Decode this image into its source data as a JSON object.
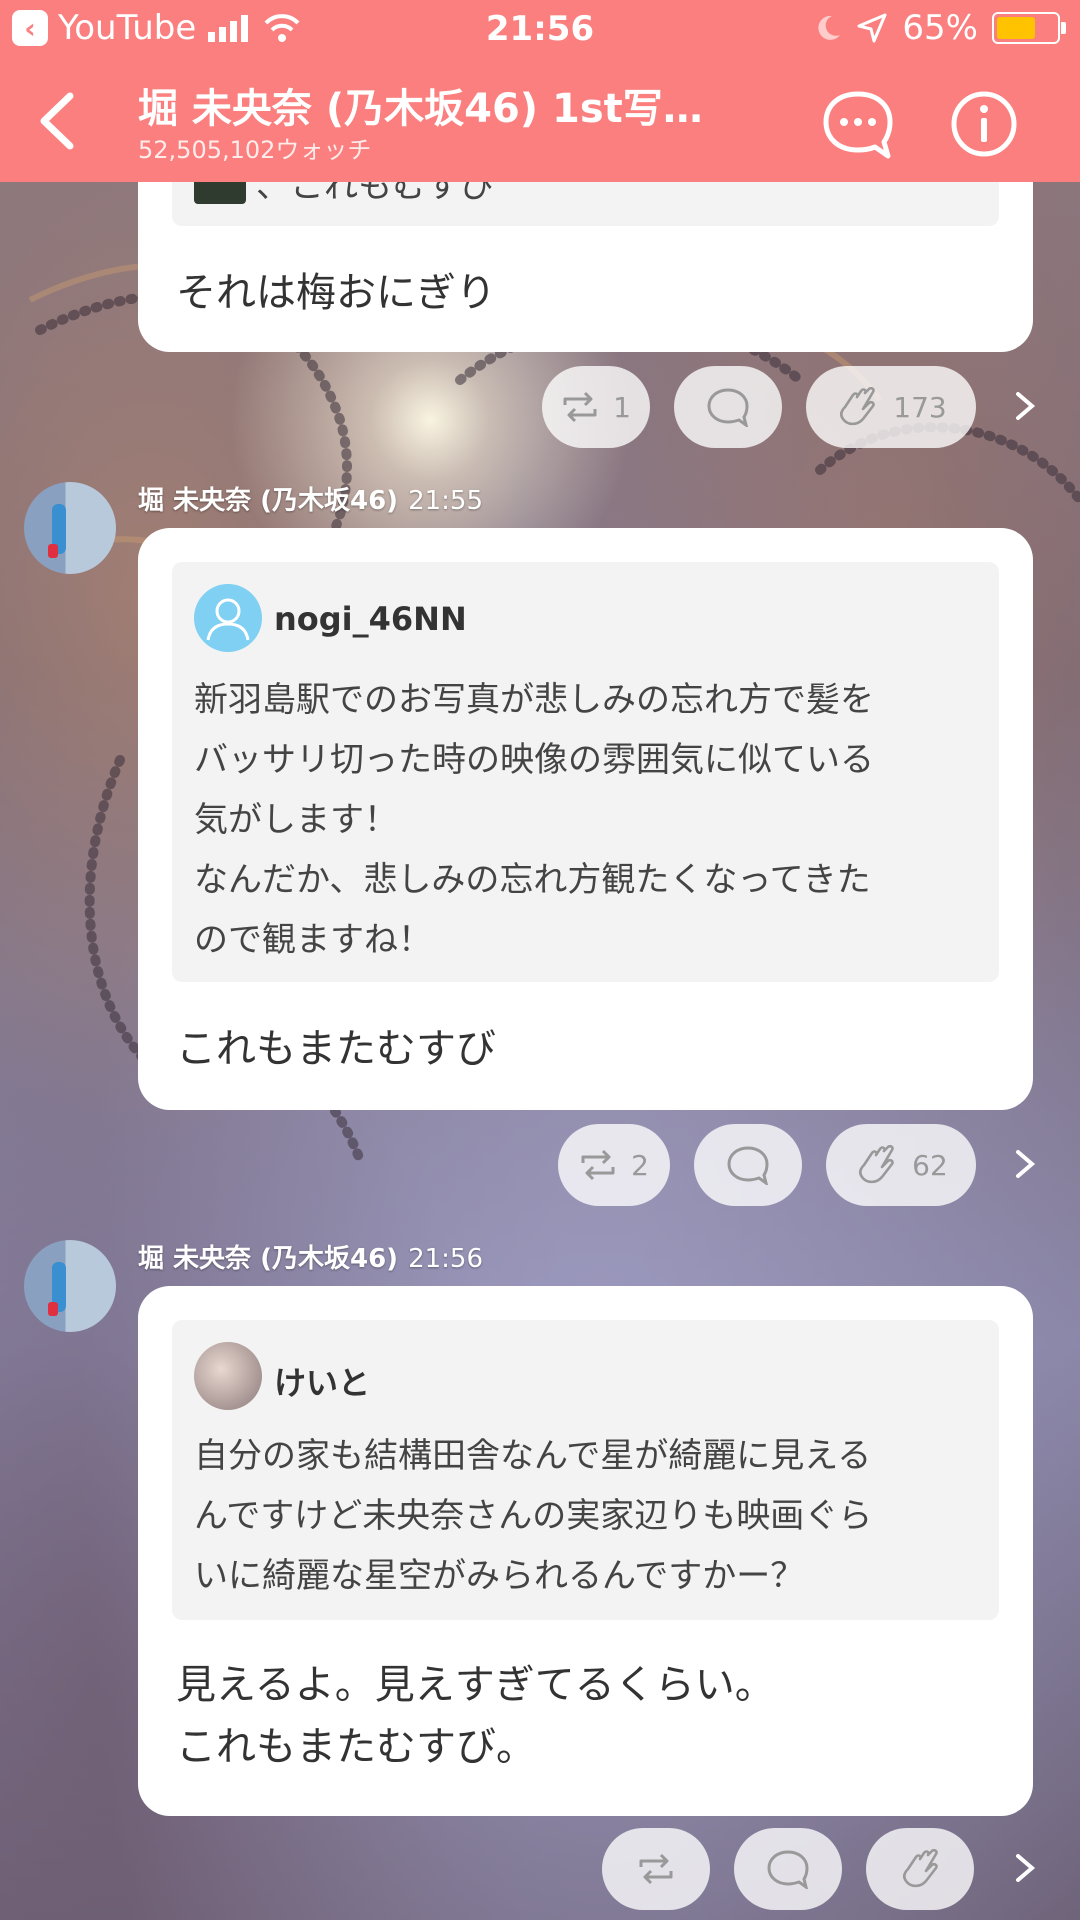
{
  "status_bar": {
    "back_app": "YouTube",
    "time": "21:56",
    "battery": "65%",
    "battery_level": 0.65
  },
  "header": {
    "title": "堀 未央奈 (乃木坂46) 1st写…",
    "watch_count": "52,505,102ウォッチ"
  },
  "top_card": {
    "quote_partial": "、これもむすび",
    "reply": "それは梅おにぎり"
  },
  "actions_1": {
    "repost": "1",
    "clap": "173"
  },
  "post_1": {
    "author": "堀 未央奈 (乃木坂46)",
    "time": "21:55",
    "quote_user": "nogi_46NN",
    "quote_text": "新羽島駅でのお写真が悲しみの忘れ方で髪を\nバッサリ切った時の映像の雰囲気に似ている\n気がします！\nなんだか、悲しみの忘れ方観たくなってきた\nので観ますね！",
    "reply": "これもまたむすび"
  },
  "actions_2": {
    "repost": "2",
    "clap": "62"
  },
  "post_2": {
    "author": "堀 未央奈 (乃木坂46)",
    "time": "21:56",
    "quote_user": "けいと",
    "quote_text": "自分の家も結構田舎なんで星が綺麗に見える\nんですけど未央奈さんの実家辺りも映画ぐら\nいに綺麗な星空がみられるんですかー？",
    "reply": "見えるよ。見えすぎてるくらい。\nこれもまたむすび。"
  },
  "colors": {
    "header": "#fa7f7e",
    "battery": "#ffc300",
    "card": "#ffffff",
    "quote_bg": "#f3f3f3"
  }
}
